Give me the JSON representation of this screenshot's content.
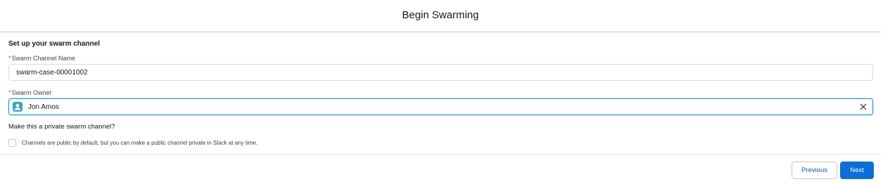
{
  "header": {
    "title": "Begin Swarming"
  },
  "form": {
    "section_title": "Set up your swarm channel",
    "required_marker": "*",
    "channel_name": {
      "label": "Swarm Channel Name",
      "value": "swarm-case-00001002"
    },
    "owner": {
      "label": "Swarm Owner",
      "value": "Jon Amos",
      "avatar_icon": "user-icon",
      "clear_icon": "close-icon"
    },
    "private": {
      "question": "Make this a private swarm channel?",
      "checkbox_label": "Channels are public by default, but you can make a public channel private in Slack at any time.",
      "checked": false
    }
  },
  "footer": {
    "previous_label": "Previous",
    "next_label": "Next"
  },
  "colors": {
    "accent": "#0b6fd8",
    "focus_border": "#1b96ff",
    "required": "#c23934",
    "avatar_bg": "#3ba4c3"
  }
}
